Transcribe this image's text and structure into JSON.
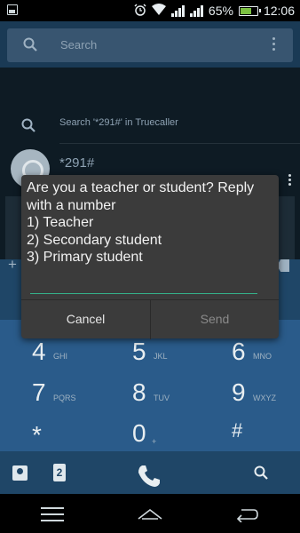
{
  "status": {
    "battery": "65%",
    "time": "12:06"
  },
  "search": {
    "placeholder": "Search"
  },
  "truecaller": {
    "label": "Search '*291#' in Truecaller"
  },
  "contact": {
    "name": "*291#"
  },
  "dialog": {
    "message": "Are you a teacher or student? Reply\nwith a number\n1) Teacher\n2) Secondary student\n3) Primary student",
    "reply_value": "",
    "cancel_label": "Cancel",
    "send_label": "Send"
  },
  "dialpad": {
    "plus": "+",
    "keys": [
      {
        "num": "4",
        "letters": "GHI"
      },
      {
        "num": "5",
        "letters": "JKL"
      },
      {
        "num": "6",
        "letters": "MNO"
      },
      {
        "num": "7",
        "letters": "PQRS"
      },
      {
        "num": "8",
        "letters": "TUV"
      },
      {
        "num": "9",
        "letters": "WXYZ"
      },
      {
        "num": "*",
        "letters": ""
      },
      {
        "num": "0",
        "letters": "+"
      },
      {
        "num": "#",
        "letters": ""
      }
    ],
    "sim_label": "2"
  },
  "icons": {
    "status_left": "image-notification-icon",
    "alarm": "alarm-icon",
    "wifi": "wifi-icon",
    "signal": "signal-icon",
    "battery": "battery-icon",
    "search": "search-icon",
    "overflow": "more-vert-icon",
    "contacts": "contacts-icon",
    "sim": "sim-icon",
    "call": "phone-icon",
    "find": "search-icon",
    "nav_menu": "menu-icon",
    "nav_home": "home-icon",
    "nav_back": "back-icon"
  },
  "colors": {
    "accent": "#35b18a",
    "dialpad": "#2a5b8a",
    "dialog": "#3b3b3b"
  }
}
